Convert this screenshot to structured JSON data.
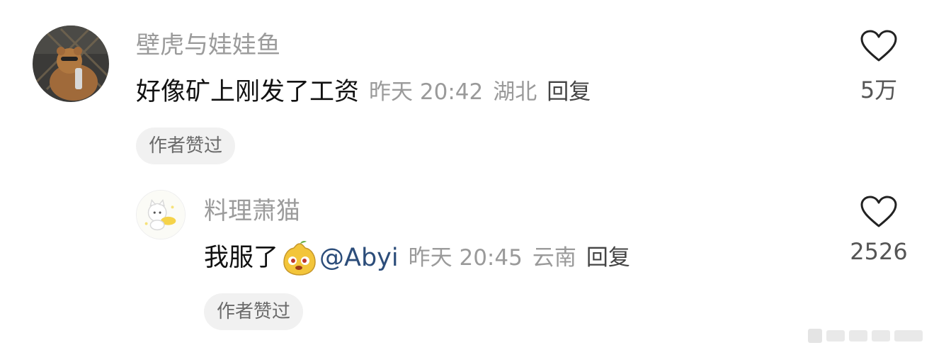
{
  "comments": [
    {
      "username": "壁虎与娃娃鱼",
      "text": "好像矿上刚发了工资",
      "time": "昨天 20:42",
      "location": "湖北",
      "reply_label": "回复",
      "badge": "作者赞过",
      "likes": "5万",
      "avatar_icon": "bear-photo-avatar"
    },
    {
      "username": "料理萧猫",
      "text": "我服了",
      "emoji_icon": "yellow-pear-emoji",
      "mention": "@Abyi",
      "time": "昨天 20:45",
      "location": "云南",
      "reply_label": "回复",
      "badge": "作者赞过",
      "likes": "2526",
      "avatar_icon": "cartoon-cat-avatar"
    }
  ],
  "colors": {
    "username": "#9b9b9b",
    "mention": "#2c4d7a",
    "badge_bg": "#f1f1f1"
  }
}
